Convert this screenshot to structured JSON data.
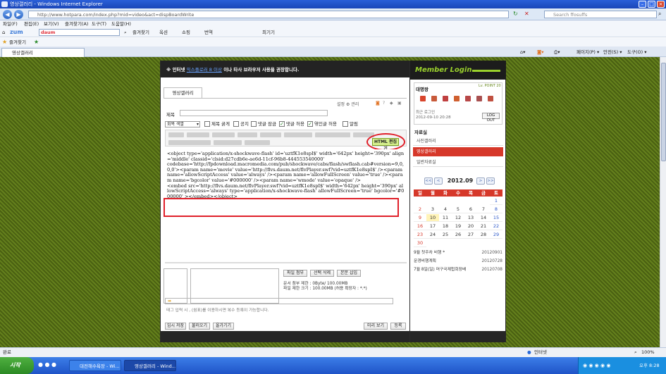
{
  "window": {
    "title": "영상갤러리 - Windows Internet Explorer"
  },
  "address": {
    "url": "http://www.hotpara.com/index.php?mid=video&act=dispBoardWrite",
    "search_placeholder": "Search ffosuffs"
  },
  "menubar": [
    "파일(F)",
    "편집(E)",
    "보기(V)",
    "즐겨찾기(A)",
    "도구(T)",
    "도움말(H)"
  ],
  "zumbar": {
    "logo": "zum",
    "search_value": "daum",
    "items": [
      "즐겨찾기",
      "옥션",
      "쇼핑",
      "번역",
      "최기기"
    ]
  },
  "favbar": {
    "label": "즐겨찾기"
  },
  "tab": {
    "label": "영상갤러리"
  },
  "cmdbar": {
    "page": "페이지(P) ▾",
    "safety": "안전(S) ▾",
    "tools": "도구(O) ▾"
  },
  "notice": {
    "prefix": "※ 인터넷 ",
    "link": "익스플로러 8 이상",
    "suffix": " 이나 타사 브라우저 사용을 권장합니다."
  },
  "board": {
    "tab": "영상갤러리",
    "top_links": "설정  ⚙ 관리",
    "title_label": "제목",
    "select_value": "회목 색깔",
    "options": [
      {
        "label": "제목 굵게",
        "checked": false
      },
      {
        "label": "공지",
        "checked": false
      },
      {
        "label": "댓글 잠금",
        "checked": false
      },
      {
        "label": "댓글 허용",
        "checked": true
      },
      {
        "label": "엮인글 허용",
        "checked": true
      },
      {
        "label": "알림",
        "checked": false
      }
    ],
    "html_button": "HTML 편집기",
    "code_lines": [
      "<object type='application/x-shockwave-flash' id='uztfK1e8spI$' width='642px' height='390px' align='middle' classid='clsid:d27cdb6e-ae6d-11cf-96b8-444553540000'",
      "codebase='http://fpdownload.macromedia.com/pub/shockwave/cabs/flash/swflash.cab#version=9,0,0,0'><param name='movie' value='http://flvs.daum.net/flvPlayer.swf?vid=uztfK1e8spI$' /><param name='allowScriptAccess' value='always' /><param name='allowFullScreen' value='true' /><param name='bgcolor' value='#000000' /><param name='wmode' value='opaque' />",
      "<embed src='http://flvs.daum.net/flvPlayer.swf?vid=uztfK1e8spI$' width='642px' height='390px' allowScriptAccess='always' type='application/x-shockwave-flash' allowFullScreen='true' bgcolor='#000000' ></embed></object>"
    ],
    "attach_buttons": [
      "파일 첨부",
      "선택 삭제",
      "본문 삽입"
    ],
    "attach_info": [
      "문서 첨부 제한 : 0Byte/ 100.00MB",
      "파일 제한 크기 : 100.00MB (허용 확장자 : *.*)"
    ],
    "tag_note": "태그 입력 시 , (쉼표)를 이용하시면 복수 등록이 가능합니다.",
    "bottom_buttons_left": [
      "임시 저장",
      "불러오기",
      "올가기기"
    ],
    "bottom_buttons_right": [
      "미리 보기",
      "등록"
    ]
  },
  "sidebar": {
    "header": "Member Login",
    "username": "대명왕",
    "level": "Lv. POINT 20",
    "last_login_label": "최근 로그인",
    "last_login": "2012-09-10 20:28",
    "logout": "LOG OUT",
    "category_heading": "자료실",
    "categories": [
      "사진갤러리",
      "영상갤러리",
      "일반자료실"
    ],
    "active_category": 1,
    "calendar": {
      "month": "2012.09",
      "nav": [
        "<<",
        "<",
        ">",
        ">>"
      ],
      "days": [
        "일",
        "월",
        "화",
        "수",
        "목",
        "금",
        "토"
      ],
      "today": 10,
      "first_weekday": 6,
      "num_days": 30
    },
    "recent": [
      {
        "title": "9월 첫주차 비행 *",
        "date": "20120901"
      },
      {
        "title": "문경비행계획",
        "date": "20120728"
      },
      {
        "title": "7월 8일(일) 머구국제헙회장배",
        "date": "20120708"
      }
    ]
  },
  "status": {
    "left": "완료",
    "zone": "인터넷",
    "zoom": "100%"
  },
  "taskbar": {
    "start": "시작",
    "tasks": [
      "대전해수욕장 - Wi...",
      "영상갤러리 - Wind..."
    ],
    "clock": "오후 8:28"
  }
}
